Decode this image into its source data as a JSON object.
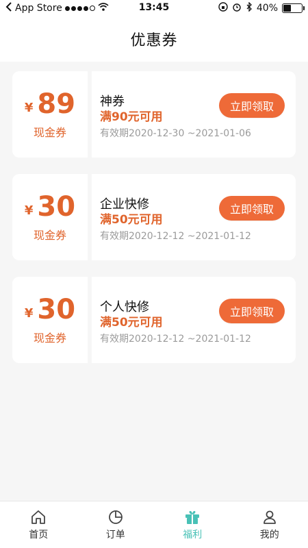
{
  "status_bar": {
    "carrier": "App Store",
    "time": "13:45",
    "battery": "40%"
  },
  "header": {
    "title": "优惠券"
  },
  "coupons": [
    {
      "currency": "¥",
      "amount": "89",
      "type": "现金券",
      "title": "神券",
      "condition": "满90元可用",
      "validity": "有效期2020-12-30 ~2021-01-06",
      "button": "立即领取"
    },
    {
      "currency": "¥",
      "amount": "30",
      "type": "现金券",
      "title": "企业快修",
      "condition": "满50元可用",
      "validity": "有效期2020-12-12 ~2021-01-12",
      "button": "立即领取"
    },
    {
      "currency": "¥",
      "amount": "30",
      "type": "现金券",
      "title": "个人快修",
      "condition": "满50元可用",
      "validity": "有效期2020-12-12 ~2021-01-12",
      "button": "立即领取"
    }
  ],
  "tabbar": {
    "items": [
      {
        "label": "首页",
        "icon": "home-icon"
      },
      {
        "label": "订单",
        "icon": "order-icon"
      },
      {
        "label": "福利",
        "icon": "gift-icon",
        "active": true
      },
      {
        "label": "我的",
        "icon": "user-icon"
      }
    ]
  },
  "colors": {
    "accent": "#ee6a38",
    "active_tab": "#49c1b6"
  }
}
